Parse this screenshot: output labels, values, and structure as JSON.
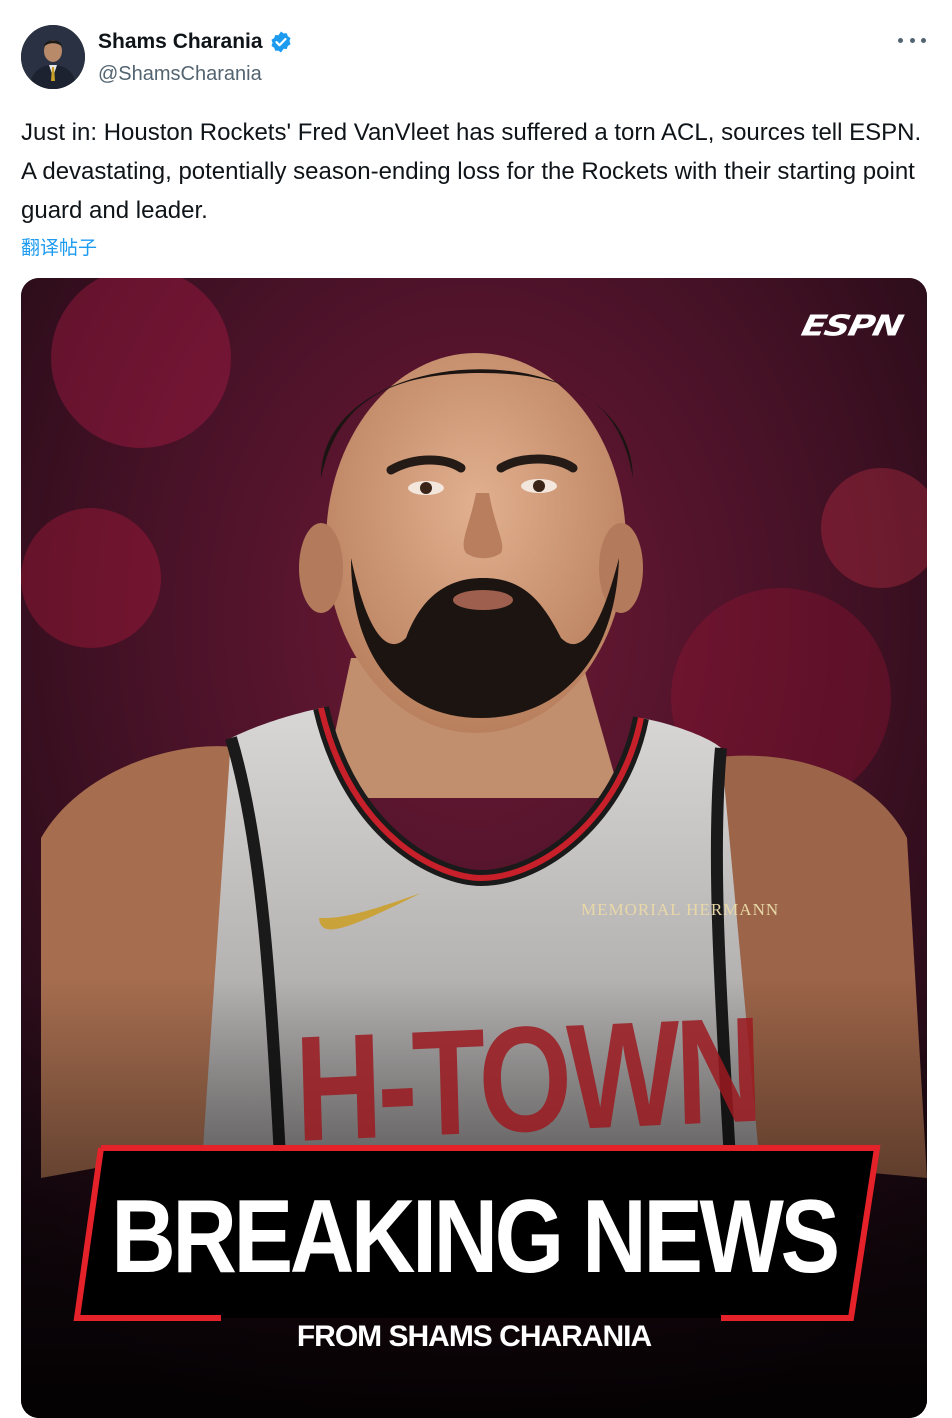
{
  "author": {
    "name": "Shams Charania",
    "handle": "@ShamsCharania",
    "verified_color": "#1d9bf0"
  },
  "tweet": {
    "text": "Just in: Houston Rockets' Fred VanVleet has suffered a torn ACL, sources tell ESPN. A devastating, potentially season-ending loss for the Rockets with their starting point guard and leader.",
    "translate_label": "翻译帖子"
  },
  "media": {
    "logo": "ESPN",
    "banner_title": "BREAKING NEWS",
    "banner_subtitle": "FROM SHAMS CHARANIA",
    "jersey_sponsor": "MEMORIAL HERMANN",
    "jersey_text": "H-TOWN",
    "accent_color": "#e5222a"
  },
  "icons": {
    "verified": "verified-badge-icon",
    "more": "more-options-icon"
  }
}
